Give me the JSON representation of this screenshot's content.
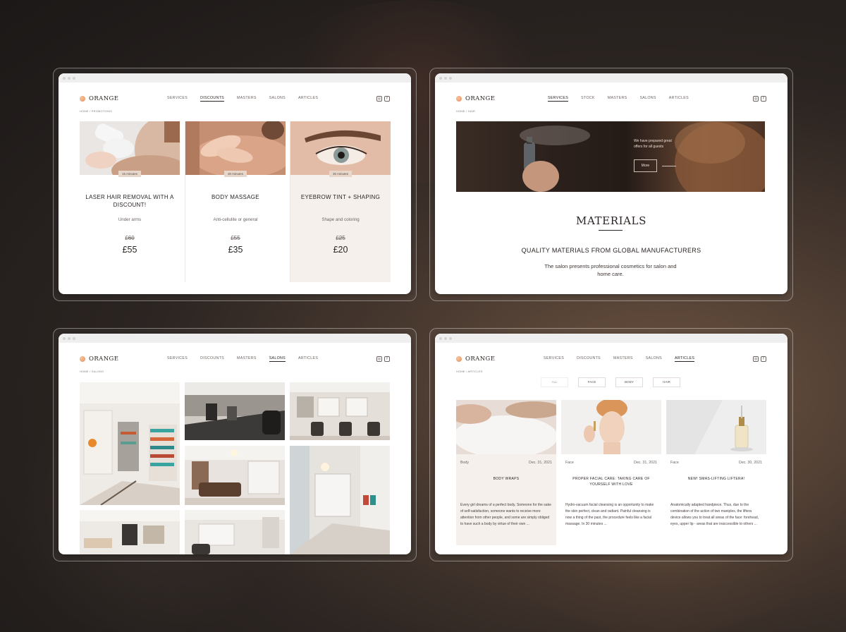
{
  "brand": {
    "name": "ORANGE",
    "accent": "#e89a64"
  },
  "social": {
    "instagram": "◎",
    "facebook": "f"
  },
  "discounts_page": {
    "nav": [
      "SERVICES",
      "DISCOUNTS",
      "MASTERS",
      "SALONS",
      "ARTICLES"
    ],
    "active": "DISCOUNTS",
    "breadcrumb": "HOME / PROMOTIONS",
    "cards": [
      {
        "duration": "15 minutes",
        "title": "LASER HAIR REMOVAL WITH A DISCOUNT!",
        "subtitle": "Under arms",
        "old_price": "£60",
        "new_price": "£55"
      },
      {
        "duration": "30 minutes",
        "title": "BODY MASSAGE",
        "subtitle": "Anti-cellulite or general",
        "old_price": "£55",
        "new_price": "£35"
      },
      {
        "duration": "30 minutes",
        "title": "EYEBROW TINT + SHAPING",
        "subtitle": "Shape and coloring",
        "old_price": "£25",
        "new_price": "£20"
      }
    ]
  },
  "services_page": {
    "nav": [
      "SERVICES",
      "STOCK",
      "MASTERS",
      "SALONS",
      "ARTICLES"
    ],
    "active": "SERVICES",
    "breadcrumb": "HOME / HAIR",
    "hero_text": "We have prepared great offers for all guests",
    "hero_button": "More",
    "section_title": "MATERIALS",
    "section_subtitle": "QUALITY MATERIALS FROM GLOBAL MANUFACTURERS",
    "section_text": "The salon presents professional cosmetics for salon and home care."
  },
  "salons_page": {
    "nav": [
      "SERVICES",
      "DISCOUNTS",
      "MASTERS",
      "SALONS",
      "ARTICLES"
    ],
    "active": "SALONS",
    "breadcrumb": "HOME / SALONS"
  },
  "articles_page": {
    "nav": [
      "SERVICES",
      "DISCOUNTS",
      "MASTERS",
      "SALONS",
      "ARTICLES"
    ],
    "active": "ARTICLES",
    "breadcrumb": "HOME / ARTICLES",
    "filters": [
      "ALL",
      "FACE",
      "BODY",
      "HAIR"
    ],
    "articles": [
      {
        "category": "Body",
        "date": "Dec. 31, 2021",
        "title": "BODY WRAPS",
        "excerpt": "Every girl dreams of a perfect body. Someone for the sake of self-satisfaction, someone wants to receive more attention from other people, and some are simply obliged to have such a body by virtue of their own ..."
      },
      {
        "category": "Face",
        "date": "Dec. 31, 2021",
        "title": "PROPER FACIAL CARE: TAKING CARE OF YOURSELF WITH LOVE",
        "excerpt": "Hydro-vacuum facial cleansing is an opportunity to make the skin perfect, clean and radiant. Painful cleansing is now a thing of the past, the procedure feels like a facial massage. In 30 minutes ..."
      },
      {
        "category": "Face",
        "date": "Dec. 30, 2021",
        "title": "NEW! SMAS-LIFTING LIFTERA!",
        "excerpt": "Anatomically adapted handpiece. Thus, due to the combination of the action of two maniples, the liftera device allows you to treat all areas of the face: forehead, eyes, upper lip - areas that are inaccessible to others ..."
      }
    ]
  }
}
